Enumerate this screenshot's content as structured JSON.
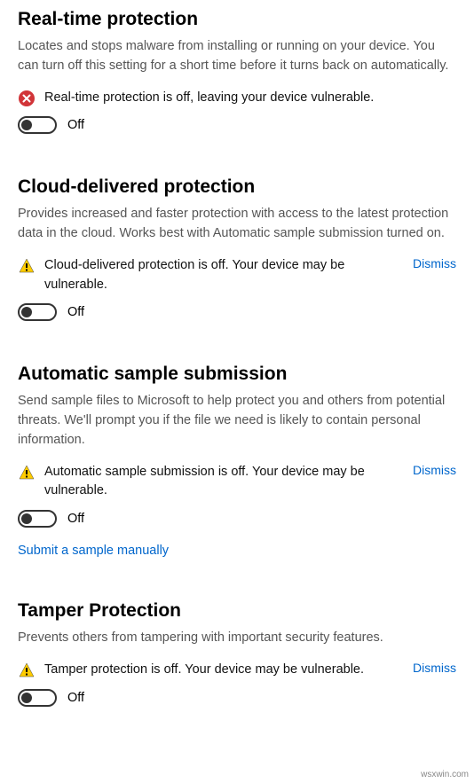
{
  "sections": {
    "realtime": {
      "title": "Real-time protection",
      "desc": "Locates and stops malware from installing or running on your device. You can turn off this setting for a short time before it turns back on automatically.",
      "alert": "Real-time protection is off, leaving your device vulnerable.",
      "toggle_label": "Off"
    },
    "cloud": {
      "title": "Cloud-delivered protection",
      "desc": "Provides increased and faster protection with access to the latest protection data in the cloud. Works best with Automatic sample submission turned on.",
      "alert": "Cloud-delivered protection is off. Your device may be vulnerable.",
      "dismiss": "Dismiss",
      "toggle_label": "Off"
    },
    "sample": {
      "title": "Automatic sample submission",
      "desc": "Send sample files to Microsoft to help protect you and others from potential threats. We'll prompt you if the file we need is likely to contain personal information.",
      "alert": "Automatic sample submission is off. Your device may be vulnerable.",
      "dismiss": "Dismiss",
      "toggle_label": "Off",
      "link": "Submit a sample manually"
    },
    "tamper": {
      "title": "Tamper Protection",
      "desc": "Prevents others from tampering with important security features.",
      "alert": "Tamper protection is off. Your device may be vulnerable.",
      "dismiss": "Dismiss",
      "toggle_label": "Off"
    }
  },
  "watermark": "wsxwin.com"
}
